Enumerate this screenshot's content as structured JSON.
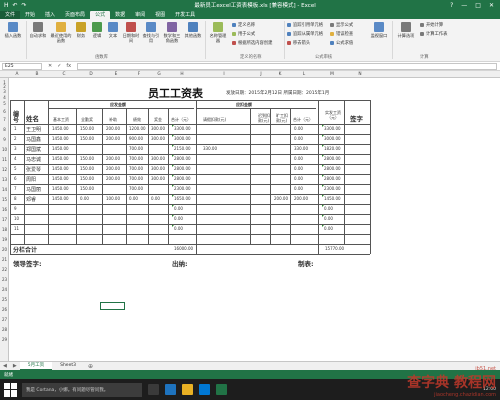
{
  "window": {
    "title": "最新员工excel工资表模板.xls [兼容模式] - Excel",
    "qat_save": "H",
    "qat_undo": "↶",
    "qat_redo": "↷"
  },
  "tabs": [
    "文件",
    "开始",
    "插入",
    "页面布局",
    "公式",
    "数据",
    "审阅",
    "视图",
    "开发工具"
  ],
  "ribbon": {
    "insert_function": "插入函数",
    "autosum": "自动求和",
    "recent": "最近使用的函数",
    "financial": "财务",
    "logical": "逻辑",
    "text": "文本",
    "datetime": "日期和时间",
    "lookup": "查找与引用",
    "math": "数学和三角函数",
    "more": "其他函数",
    "library_label": "函数库",
    "name_manager": "名称管理器",
    "define_name": "定义名称",
    "use_in_formula": "用于公式",
    "create_from_sel": "根据所选内容创建",
    "names_label": "定义的名称",
    "trace_prec": "追踪引用单元格",
    "trace_dep": "追踪从属单元格",
    "remove_arrows": "移去箭头",
    "show_formulas": "显示公式",
    "error_check": "错误检查",
    "eval_formula": "公式求值",
    "audit_label": "公式审核",
    "watch": "监视窗口",
    "calc_options": "计算选项",
    "calc_now": "开始计算",
    "calc_sheet": "计算工作表",
    "calc_label": "计算"
  },
  "formula_bar": {
    "name_box": "E25",
    "cancel": "✕",
    "enter": "✓",
    "fx": "fx"
  },
  "columns": [
    "A",
    "B",
    "C",
    "D",
    "E",
    "F",
    "G",
    "H",
    "I",
    "J",
    "K",
    "L",
    "M",
    "N"
  ],
  "rows": [
    "1",
    "2",
    "3",
    "4",
    "5",
    "6",
    "7",
    "8",
    "9",
    "10",
    "11",
    "12",
    "13",
    "14",
    "15",
    "16",
    "17",
    "18",
    "19",
    "20",
    "21",
    "22",
    "23",
    "24",
    "25",
    "26",
    "27",
    "28",
    "29"
  ],
  "sheet": {
    "title": "员工工资表",
    "date_info": "发放日期：2015年2月12日  所属日期：2015年1月",
    "h_no": "编号",
    "h_name": "姓名",
    "h_payable": "应发金额",
    "h_base": "基本工资",
    "h_allow": "全勤奖",
    "h_subsidy": "补助",
    "h_perf": "绩效",
    "h_bonus": "奖金",
    "h_total": "合计（元）",
    "h_deduct": "应扣金额",
    "h_ded1": "请假扣款(元)",
    "h_ded2": "迟到扣款(元)",
    "h_ded3": "旷工扣款(元)",
    "h_ded4": "合计（元）",
    "h_net": "实发工资（元）",
    "h_sign": "签字",
    "subtotal": "分栏合计",
    "subtotal_total": "16000.00",
    "subtotal_net": "15770.00",
    "leader": "领导签字:",
    "cashier": "出纳:",
    "maker": "制表:",
    "data_rows": [
      {
        "no": "1",
        "name": "王卫明",
        "base": "1450.00",
        "allow": "150.00",
        "sub": "200.00",
        "perf": "1200.00",
        "bonus": "300.00",
        "total": "3300.00",
        "d1": "",
        "d2": "",
        "d3": "",
        "d4": "0.00",
        "net": "3300.00"
      },
      {
        "no": "2",
        "name": "马国鑫",
        "base": "1450.00",
        "allow": "150.00",
        "sub": "200.00",
        "perf": "900.00",
        "bonus": "300.00",
        "total": "3000.00",
        "d1": "",
        "d2": "",
        "d3": "",
        "d4": "0.00",
        "net": "3000.00"
      },
      {
        "no": "3",
        "name": "郑国斌",
        "base": "1450.00",
        "allow": "",
        "sub": "",
        "perf": "700.00",
        "bonus": "",
        "total": "2150.00",
        "d1": "330.00",
        "d2": "",
        "d3": "",
        "d4": "330.00",
        "net": "1820.00"
      },
      {
        "no": "4",
        "name": "马忠诚",
        "base": "1450.00",
        "allow": "150.00",
        "sub": "200.00",
        "perf": "700.00",
        "bonus": "300.00",
        "total": "2800.00",
        "d1": "",
        "d2": "",
        "d3": "",
        "d4": "0.00",
        "net": "2800.00"
      },
      {
        "no": "5",
        "name": "张爱琴",
        "base": "1450.00",
        "allow": "150.00",
        "sub": "200.00",
        "perf": "700.00",
        "bonus": "300.00",
        "total": "2800.00",
        "d1": "",
        "d2": "",
        "d3": "",
        "d4": "0.00",
        "net": "2800.00"
      },
      {
        "no": "6",
        "name": "周阳",
        "base": "1450.00",
        "allow": "150.00",
        "sub": "200.00",
        "perf": "700.00",
        "bonus": "300.00",
        "total": "2800.00",
        "d1": "",
        "d2": "",
        "d3": "",
        "d4": "0.00",
        "net": "2800.00"
      },
      {
        "no": "7",
        "name": "马国丽",
        "base": "1450.00",
        "allow": "150.00",
        "sub": "",
        "perf": "700.00",
        "bonus": "",
        "total": "2300.00",
        "d1": "",
        "d2": "",
        "d3": "",
        "d4": "0.00",
        "net": "2300.00"
      },
      {
        "no": "8",
        "name": "邓睿",
        "base": "1450.00",
        "allow": "0.00",
        "sub": "100.00",
        "perf": "0.00",
        "bonus": "0.00",
        "total": "1650.00",
        "d1": "",
        "d2": "",
        "d3": "200.00",
        "d4": "200.00",
        "net": "1450.00"
      },
      {
        "no": "9",
        "name": "",
        "base": "",
        "allow": "",
        "sub": "",
        "perf": "",
        "bonus": "",
        "total": "0.00",
        "d1": "",
        "d2": "",
        "d3": "",
        "d4": "",
        "net": "0.00"
      },
      {
        "no": "10",
        "name": "",
        "base": "",
        "allow": "",
        "sub": "",
        "perf": "",
        "bonus": "",
        "total": "0.00",
        "d1": "",
        "d2": "",
        "d3": "",
        "d4": "",
        "net": "0.00"
      },
      {
        "no": "11",
        "name": "",
        "base": "",
        "allow": "",
        "sub": "",
        "perf": "",
        "bonus": "",
        "total": "0.00",
        "d1": "",
        "d2": "",
        "d3": "",
        "d4": "",
        "net": "0.00"
      }
    ]
  },
  "sheet_tabs": [
    "5月工资",
    "Sheet3"
  ],
  "status": "就绪",
  "taskbar": {
    "search_placeholder": "我是 Cortana，小娜。有问题尽管问我。",
    "time": "12:00"
  },
  "watermark": {
    "line1": "查字典 教程网",
    "line2": "jiaocheng.chazidian.com",
    "line3": "ib51.net"
  },
  "colors": {
    "accent": "#217346",
    "border": "#555555",
    "selection": "#217346"
  }
}
